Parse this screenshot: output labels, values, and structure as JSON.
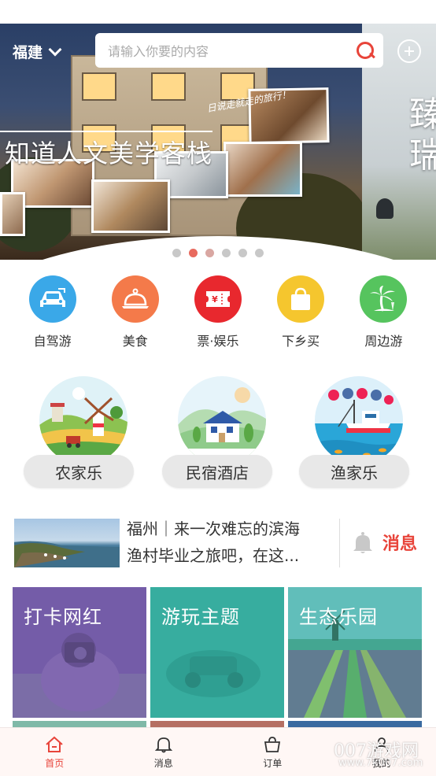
{
  "header": {
    "city": "福建",
    "search_placeholder": "请输入你要的内容"
  },
  "banner": {
    "title": "知道人文美学客栈",
    "tagline": "日说走就走的旅行！",
    "next_slide_text": "臻瑞",
    "slide_count": 6,
    "active_slide": 2
  },
  "categories": [
    {
      "label": "自驾游",
      "icon": "car-icon",
      "color": "#3aa8e8"
    },
    {
      "label": "美食",
      "icon": "food-cloche-icon",
      "color": "#f47a4a"
    },
    {
      "label": "票·娱乐",
      "icon": "ticket-icon",
      "color": "#e8282e"
    },
    {
      "label": "下乡买",
      "icon": "shopping-bag-icon",
      "color": "#f5c62e"
    },
    {
      "label": "周边游",
      "icon": "palm-tree-icon",
      "color": "#56c45e"
    }
  ],
  "featured": [
    {
      "label": "农家乐",
      "icon": "farm-windmill-illustration"
    },
    {
      "label": "民宿酒店",
      "icon": "homestay-illustration"
    },
    {
      "label": "渔家乐",
      "icon": "fishing-boat-illustration"
    }
  ],
  "news": {
    "line1": "福州｜来一次难忘的滨海",
    "line2": "渔村毕业之旅吧，在这...",
    "messages_label": "消息"
  },
  "themes": [
    {
      "label": "打卡网红",
      "overlay": "#7a5fb0"
    },
    {
      "label": "游玩主题",
      "overlay": "#33b3a4"
    },
    {
      "label": "生态乐园",
      "overlay": "#2aa79a"
    }
  ],
  "tabbar": {
    "items": [
      {
        "label": "首页",
        "icon": "home-icon",
        "active": true
      },
      {
        "label": "消息",
        "icon": "bell-icon",
        "active": false
      },
      {
        "label": "订单",
        "icon": "bag-icon",
        "active": false
      },
      {
        "label": "我的",
        "icon": "user-icon",
        "active": false
      }
    ]
  },
  "watermark": {
    "title": "007游戏网",
    "url": "www.7k007.com"
  }
}
